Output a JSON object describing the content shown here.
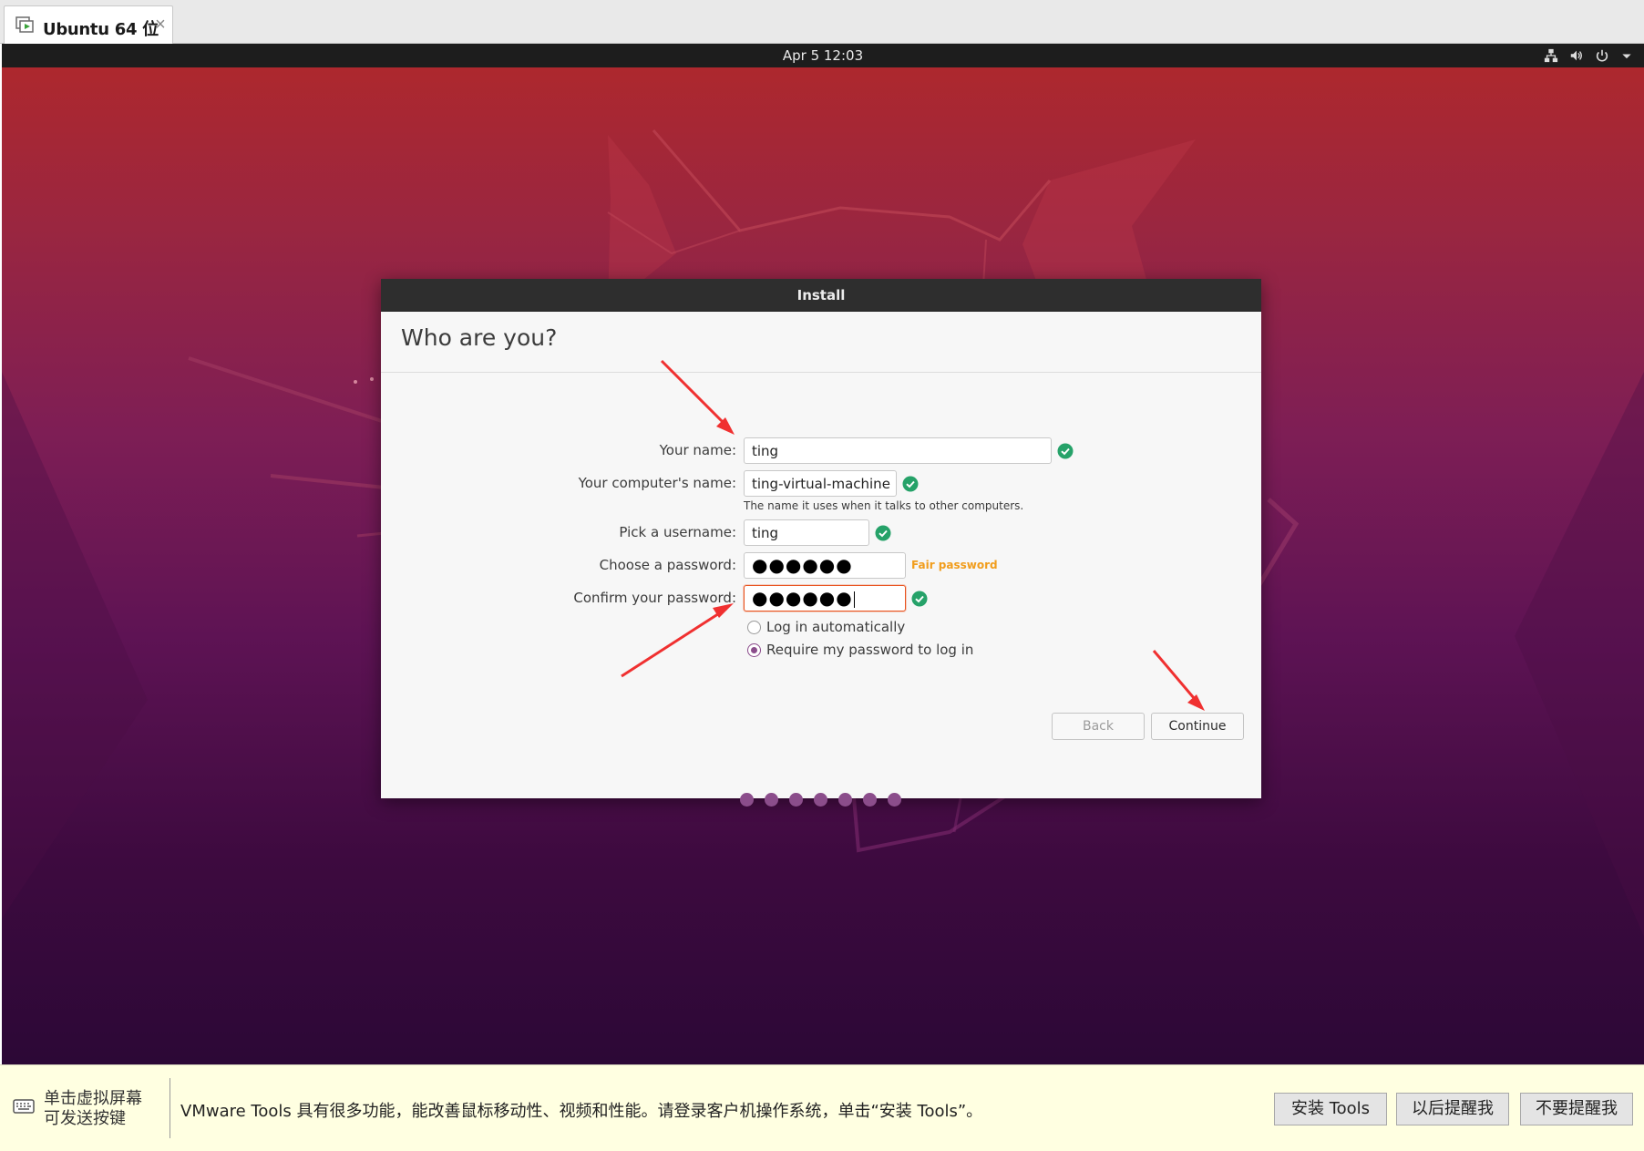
{
  "vm_tab": {
    "title": "Ubuntu 64 位",
    "close_glyph": "×"
  },
  "topbar": {
    "clock": "Apr 5  12:03",
    "tray_icons": [
      "network-icon",
      "volume-icon",
      "power-icon",
      "menu-arrow-icon"
    ]
  },
  "installer": {
    "window_title": "Install",
    "heading": "Who are you?",
    "fields": {
      "name": {
        "label": "Your name:",
        "value": "ting"
      },
      "computer": {
        "label": "Your computer's name:",
        "value": "ting-virtual-machine",
        "hint": "The name it uses when it talks to other computers."
      },
      "username": {
        "label": "Pick a username:",
        "value": "ting"
      },
      "password": {
        "label": "Choose a password:",
        "value": "●●●●●●",
        "strength": "Fair password"
      },
      "confirm": {
        "label": "Confirm your password:",
        "value": "●●●●●●"
      }
    },
    "login_options": [
      {
        "label": "Log in automatically",
        "selected": false
      },
      {
        "label": "Require my password to log in",
        "selected": true
      }
    ],
    "buttons": {
      "back": "Back",
      "continue": "Continue"
    },
    "progress_dots": 7,
    "colors": {
      "accent": "#e95420",
      "ok_green": "#26a269",
      "dot_purple": "#8b4d8b",
      "strength_orange": "#f19d1c"
    }
  },
  "tools_bar": {
    "keyboard_hint_line1": "单击虚拟屏幕",
    "keyboard_hint_line2": "可发送按键",
    "message": "VMware Tools 具有很多功能，能改善鼠标移动性、视频和性能。请登录客户机操作系统，单击“安装 Tools”。",
    "buttons": {
      "install": "安装 Tools",
      "later": "以后提醒我",
      "never": "不要提醒我"
    }
  }
}
